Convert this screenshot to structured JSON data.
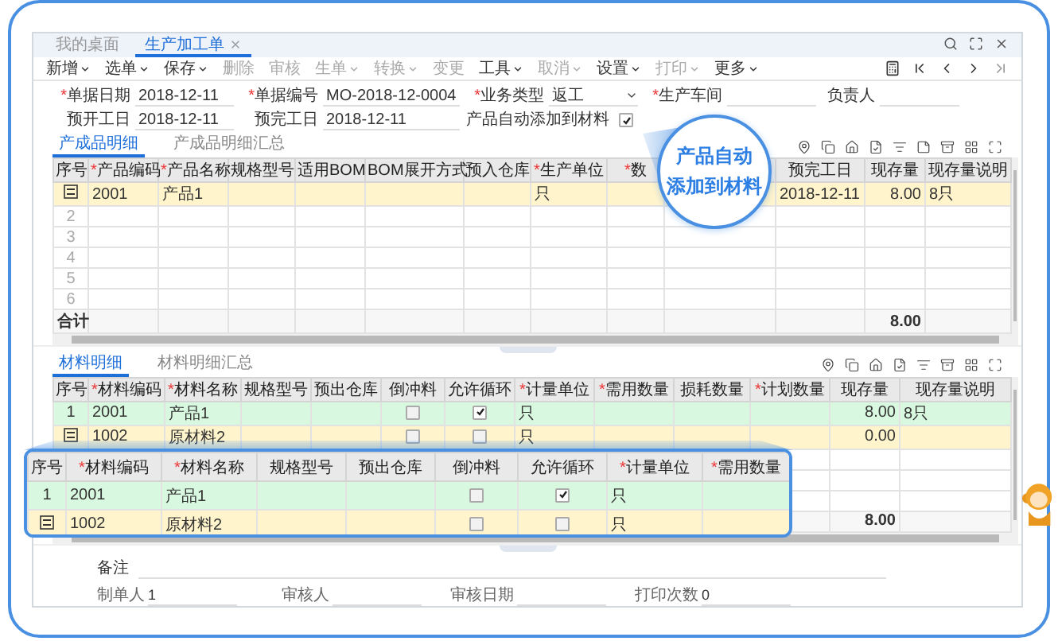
{
  "tabs": [
    {
      "label": "我的桌面",
      "selected": false,
      "closable": false
    },
    {
      "label": "生产加工单",
      "selected": true,
      "closable": true
    }
  ],
  "toolbar": [
    {
      "label": "新增",
      "dropdown": true,
      "disabled": false
    },
    {
      "label": "选单",
      "dropdown": true,
      "disabled": false
    },
    {
      "label": "保存",
      "dropdown": true,
      "disabled": false
    },
    {
      "label": "删除",
      "dropdown": false,
      "disabled": true
    },
    {
      "label": "审核",
      "dropdown": false,
      "disabled": true
    },
    {
      "label": "生单",
      "dropdown": true,
      "disabled": true
    },
    {
      "label": "转换",
      "dropdown": true,
      "disabled": true
    },
    {
      "label": "变更",
      "dropdown": false,
      "disabled": true
    },
    {
      "label": "工具",
      "dropdown": true,
      "disabled": false
    },
    {
      "label": "取消",
      "dropdown": true,
      "disabled": true
    },
    {
      "label": "设置",
      "dropdown": true,
      "disabled": false
    },
    {
      "label": "打印",
      "dropdown": true,
      "disabled": true
    },
    {
      "label": "更多",
      "dropdown": true,
      "disabled": false
    }
  ],
  "form_rows": [
    [
      {
        "mark": "*",
        "label": "单据日期",
        "value": "2018-12-11",
        "kind": "text"
      },
      {
        "mark": "*",
        "label": "单据编号",
        "value": "MO-2018-12-0004",
        "kind": "text"
      },
      {
        "mark": "*",
        "label": "业务类型",
        "value": "返工",
        "kind": "select"
      },
      {
        "mark": "*",
        "label": "生产车间",
        "kind": "text"
      },
      {
        "label": "负责人",
        "kind": "text"
      }
    ],
    [
      {
        "label": "预开工日",
        "value": "2018-12-11",
        "kind": "text"
      },
      {
        "label": "预完工日",
        "value": "2018-12-11",
        "kind": "text"
      },
      {
        "label": "产品自动添加到材料",
        "kind": "checkbox",
        "checked": true
      }
    ]
  ],
  "product_tabs": [
    {
      "label": "产成品明细",
      "selected": true
    },
    {
      "label": "产成品明细汇总",
      "selected": false
    }
  ],
  "product_table": {
    "columns": [
      {
        "kind": "label",
        "label": "序号"
      },
      {
        "kind": "label",
        "mark": "*",
        "label": "产品编码"
      },
      {
        "kind": "label",
        "mark": "*",
        "label": "产品名称"
      },
      {
        "kind": "label",
        "label": "规格型号"
      },
      {
        "kind": "label",
        "label": "适用BOM"
      },
      {
        "kind": "label",
        "label": "BOM展开方式"
      },
      {
        "kind": "label",
        "label": "预入仓库"
      },
      {
        "kind": "label",
        "mark": "*",
        "label": "生产单位"
      },
      {
        "kind": "label",
        "mark": "*",
        "label": "数"
      },
      {
        "kind": "empty"
      },
      {
        "kind": "label",
        "label": "预完工日"
      },
      {
        "kind": "label",
        "label": "现存量"
      },
      {
        "kind": "label",
        "label": "现存量说明"
      }
    ],
    "rows": [
      {
        "current": true,
        "selected": false,
        "cells": [
          {
            "kind": "icon"
          },
          {
            "kind": "text",
            "text": "2001"
          },
          {
            "kind": "text",
            "text": "产品1"
          },
          {
            "kind": "empty"
          },
          {
            "kind": "empty"
          },
          {
            "kind": "empty"
          },
          {
            "kind": "empty"
          },
          {
            "kind": "text",
            "text": "只"
          },
          {
            "kind": "empty"
          },
          {
            "kind": "empty"
          },
          {
            "kind": "text",
            "text": "2018-12-11"
          },
          {
            "kind": "amount",
            "text": "8.00"
          },
          {
            "kind": "text",
            "text": "8只"
          }
        ]
      },
      {
        "current": false,
        "selected": false,
        "cells": [
          {
            "kind": "number",
            "text": "2"
          }
        ]
      },
      {
        "current": false,
        "selected": false,
        "cells": [
          {
            "kind": "number",
            "text": "3"
          }
        ]
      },
      {
        "current": false,
        "selected": false,
        "cells": [
          {
            "kind": "number",
            "text": "4"
          }
        ]
      },
      {
        "current": false,
        "selected": false,
        "cells": [
          {
            "kind": "number",
            "text": "5"
          }
        ]
      },
      {
        "current": false,
        "selected": false,
        "cells": [
          {
            "kind": "number",
            "text": "6"
          }
        ]
      }
    ],
    "total": [
      {
        "kind": "text",
        "text": "合计"
      },
      {
        "kind": "empty"
      },
      {
        "kind": "empty"
      },
      {
        "kind": "empty"
      },
      {
        "kind": "empty"
      },
      {
        "kind": "empty"
      },
      {
        "kind": "empty"
      },
      {
        "kind": "empty"
      },
      {
        "kind": "empty"
      },
      {
        "kind": "empty"
      },
      {
        "kind": "empty"
      },
      {
        "kind": "amount",
        "text": "8.00"
      }
    ]
  },
  "material_tabs": [
    {
      "label": "材料明细",
      "selected": true
    },
    {
      "label": "材料明细汇总",
      "selected": false
    }
  ],
  "material_table": {
    "columns": [
      {
        "kind": "label",
        "label": "序号"
      },
      {
        "kind": "label",
        "mark": "*",
        "label": "材料编码"
      },
      {
        "kind": "label",
        "mark": "*",
        "label": "材料名称"
      },
      {
        "kind": "label",
        "label": "规格型号"
      },
      {
        "kind": "label",
        "label": "预出仓库"
      },
      {
        "kind": "label",
        "label": "倒冲料"
      },
      {
        "kind": "label",
        "label": "允许循环"
      },
      {
        "kind": "label",
        "mark": "*",
        "label": "计量单位"
      },
      {
        "kind": "label",
        "mark": "*",
        "label": "需用数量"
      },
      {
        "kind": "label",
        "label": "损耗数量"
      },
      {
        "kind": "label",
        "mark": "*",
        "label": "计划数量"
      },
      {
        "kind": "label",
        "label": "现存量"
      },
      {
        "kind": "label",
        "label": "现存量说明"
      }
    ],
    "rows": [
      {
        "current": false,
        "selected": true,
        "cells": [
          {
            "kind": "number",
            "text": "1"
          },
          {
            "kind": "text",
            "text": "2001"
          },
          {
            "kind": "text",
            "text": "产品1"
          },
          {
            "kind": "empty"
          },
          {
            "kind": "empty"
          },
          {
            "kind": "checkbox",
            "checked": false
          },
          {
            "kind": "checkbox",
            "checked": true
          },
          {
            "kind": "text",
            "text": "只"
          },
          {
            "kind": "empty"
          },
          {
            "kind": "empty"
          },
          {
            "kind": "empty"
          },
          {
            "kind": "amount",
            "text": "8.00"
          },
          {
            "kind": "text",
            "text": "8只"
          }
        ]
      },
      {
        "current": true,
        "selected": false,
        "cells": [
          {
            "kind": "icon"
          },
          {
            "kind": "text",
            "text": "1002"
          },
          {
            "kind": "text",
            "text": "原材料2"
          },
          {
            "kind": "empty"
          },
          {
            "kind": "empty"
          },
          {
            "kind": "checkbox",
            "checked": false
          },
          {
            "kind": "checkbox",
            "checked": false
          },
          {
            "kind": "text",
            "text": "只"
          },
          {
            "kind": "empty"
          },
          {
            "kind": "empty"
          },
          {
            "kind": "empty"
          },
          {
            "kind": "amount",
            "text": "0.00"
          }
        ]
      }
    ],
    "total": [
      {
        "kind": "empty"
      },
      {
        "kind": "empty"
      },
      {
        "kind": "empty"
      },
      {
        "kind": "empty"
      },
      {
        "kind": "empty"
      },
      {
        "kind": "empty"
      },
      {
        "kind": "empty"
      },
      {
        "kind": "empty"
      },
      {
        "kind": "empty"
      },
      {
        "kind": "empty"
      },
      {
        "kind": "empty"
      },
      {
        "kind": "amount",
        "text": "8.00"
      }
    ]
  },
  "magnifier": {
    "columns": [
      {
        "kind": "label",
        "label": "序号"
      },
      {
        "kind": "label",
        "mark": "*",
        "label": "材料编码"
      },
      {
        "kind": "label",
        "mark": "*",
        "label": "材料名称"
      },
      {
        "kind": "label",
        "label": "规格型号"
      },
      {
        "kind": "label",
        "label": "预出仓库"
      },
      {
        "kind": "label",
        "label": "倒冲料"
      },
      {
        "kind": "label",
        "label": "允许循环"
      },
      {
        "kind": "label",
        "mark": "*",
        "label": "计量单位"
      },
      {
        "kind": "label",
        "mark": "*",
        "label": "需用数量"
      }
    ],
    "rows": [
      {
        "current": false,
        "selected": true,
        "cells": [
          {
            "kind": "number",
            "text": "1"
          },
          {
            "kind": "text",
            "text": "2001"
          },
          {
            "kind": "text",
            "text": "产品1"
          },
          {
            "kind": "empty"
          },
          {
            "kind": "empty"
          },
          {
            "kind": "checkbox",
            "checked": false
          },
          {
            "kind": "checkbox",
            "checked": true
          },
          {
            "kind": "text",
            "text": "只"
          }
        ]
      },
      {
        "current": true,
        "selected": false,
        "cells": [
          {
            "kind": "icon"
          },
          {
            "kind": "text",
            "text": "1002"
          },
          {
            "kind": "text",
            "text": "原材料2"
          },
          {
            "kind": "empty"
          },
          {
            "kind": "empty"
          },
          {
            "kind": "checkbox",
            "checked": false
          },
          {
            "kind": "checkbox",
            "checked": false
          },
          {
            "kind": "text",
            "text": "只"
          }
        ]
      }
    ]
  },
  "callout": {
    "lines": [
      "产品自动",
      "添加到材料"
    ]
  },
  "remarks": {
    "label": "备注"
  },
  "footer": [
    {
      "label": "制单人",
      "value": "1"
    },
    {
      "label": "审核人"
    },
    {
      "label": "审核日期"
    },
    {
      "label": "打印次数",
      "value": "0"
    }
  ]
}
